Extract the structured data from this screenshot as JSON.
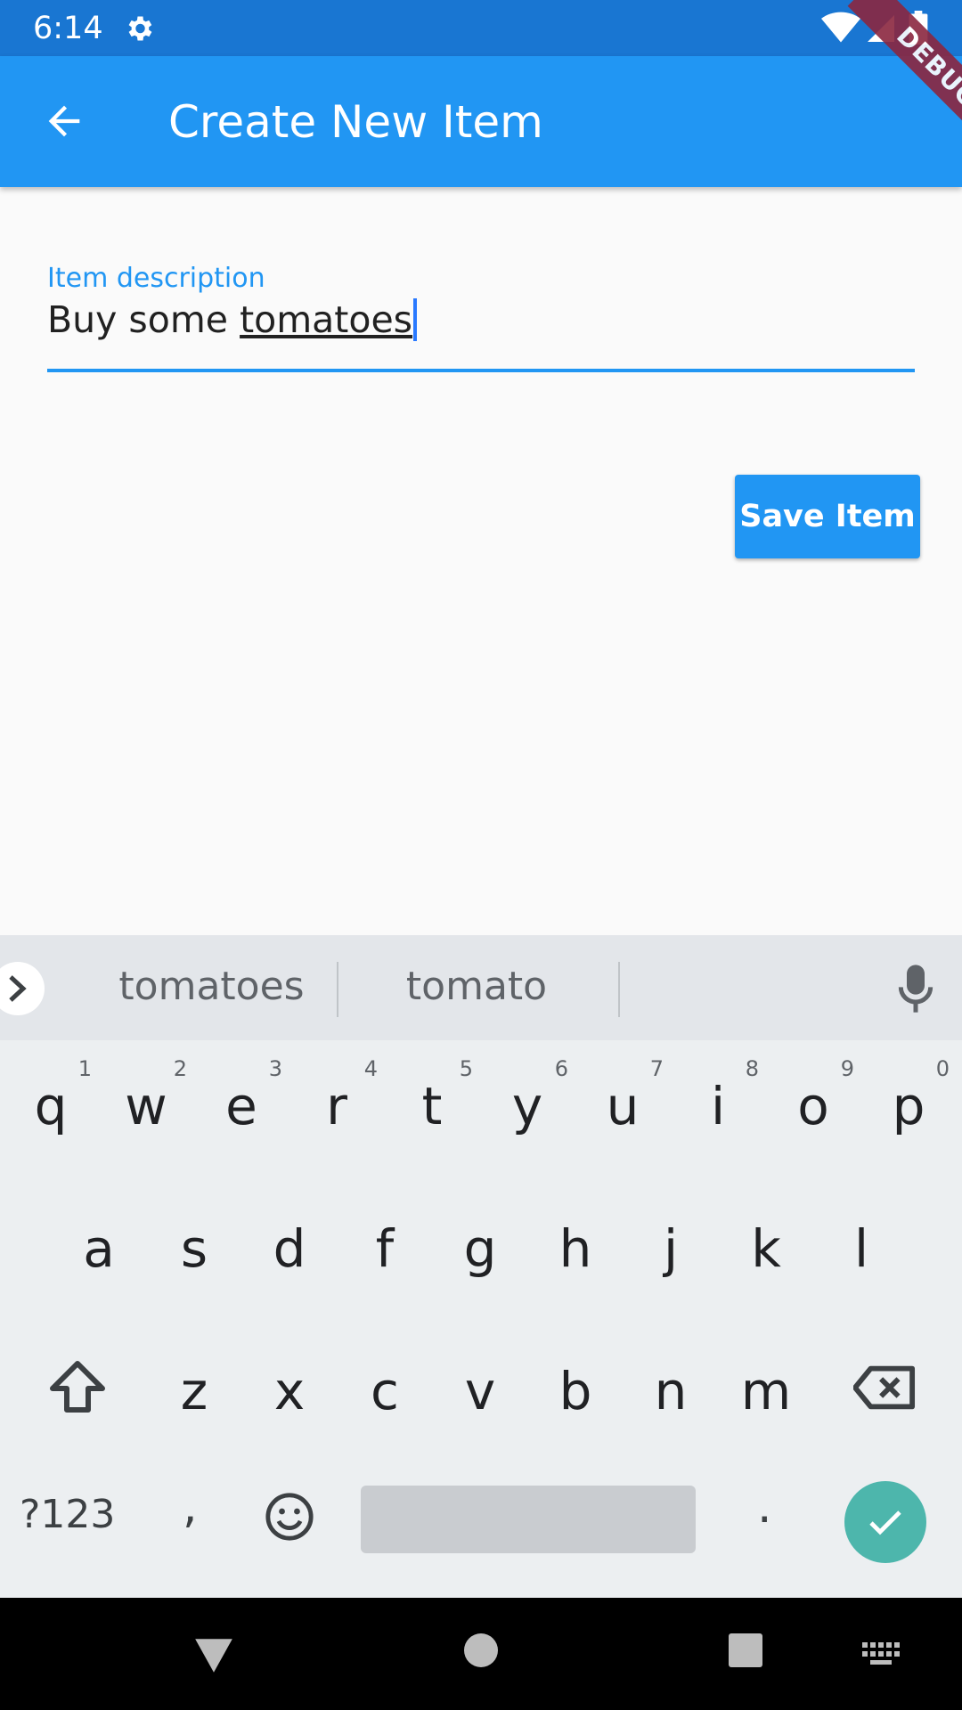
{
  "status_bar": {
    "time": "6:14"
  },
  "debug_banner": "DEBUG",
  "app_bar": {
    "title": "Create New Item"
  },
  "form": {
    "field_label": "Item description",
    "value_prefix": "Buy some ",
    "value_underlined": "tomatoes"
  },
  "save_button": {
    "label": "Save Item"
  },
  "keyboard": {
    "suggestions": [
      "tomatoes",
      "tomato"
    ],
    "row1": [
      {
        "key": "q",
        "hint": "1"
      },
      {
        "key": "w",
        "hint": "2"
      },
      {
        "key": "e",
        "hint": "3"
      },
      {
        "key": "r",
        "hint": "4"
      },
      {
        "key": "t",
        "hint": "5"
      },
      {
        "key": "y",
        "hint": "6"
      },
      {
        "key": "u",
        "hint": "7"
      },
      {
        "key": "i",
        "hint": "8"
      },
      {
        "key": "o",
        "hint": "9"
      },
      {
        "key": "p",
        "hint": "0"
      }
    ],
    "row2": [
      "a",
      "s",
      "d",
      "f",
      "g",
      "h",
      "j",
      "k",
      "l"
    ],
    "row3": [
      "z",
      "x",
      "c",
      "v",
      "b",
      "n",
      "m"
    ],
    "symbols_label": "?123",
    "comma": ",",
    "period": "."
  },
  "colors": {
    "status_bar": "#1976d2",
    "app_bar": "#2196f3",
    "accent": "#2196f3",
    "enter_key": "#4db6ac",
    "debug_ribbon": "#8b2740"
  },
  "icons": {
    "status": [
      "settings-icon",
      "wifi-icon",
      "signal-icon",
      "battery-icon"
    ],
    "app_bar": "arrow-back-icon",
    "keyboard": [
      "chevron-right-icon",
      "mic-icon",
      "shift-icon",
      "backspace-icon",
      "emoji-icon",
      "check-icon"
    ],
    "nav": [
      "nav-back-icon",
      "nav-home-icon",
      "nav-recents-icon",
      "keyboard-switch-icon"
    ]
  }
}
